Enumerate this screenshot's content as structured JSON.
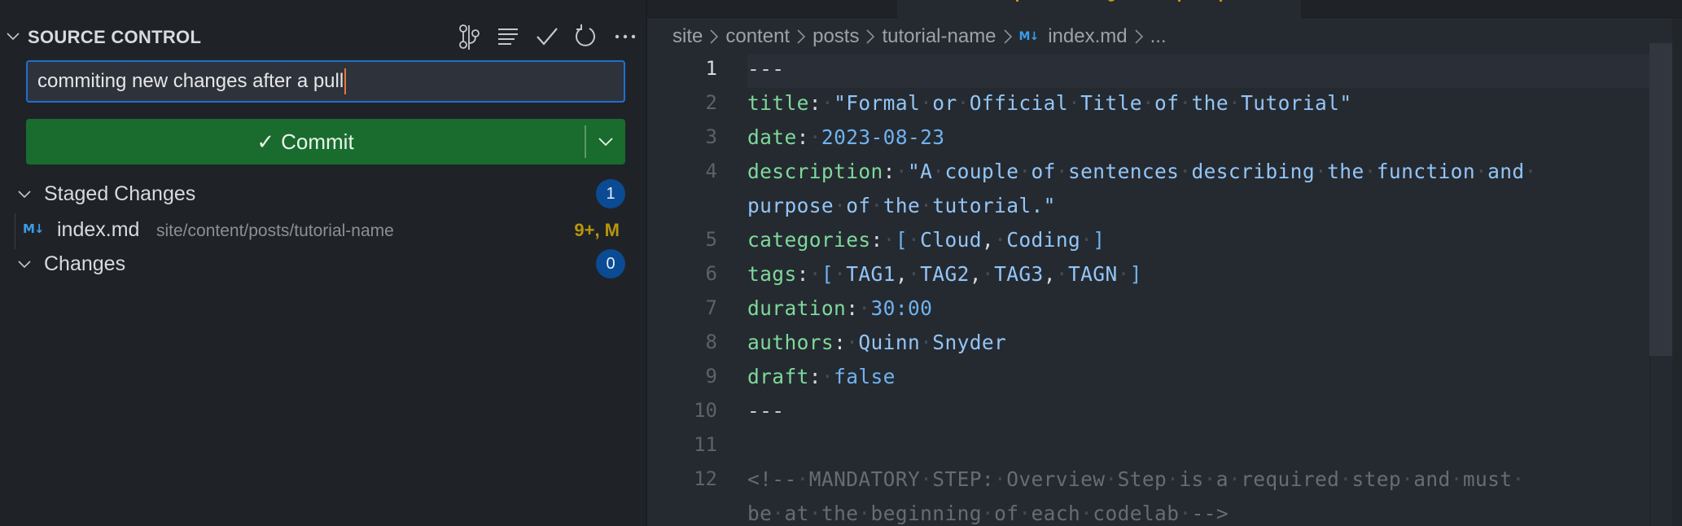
{
  "sidebar": {
    "title": "SOURCE CONTROL",
    "actions": [
      {
        "name": "view-graph",
        "icon": "git-graph-icon"
      },
      {
        "name": "view-as-tree",
        "icon": "list-icon"
      },
      {
        "name": "commit",
        "icon": "check-icon"
      },
      {
        "name": "refresh",
        "icon": "refresh-icon"
      },
      {
        "name": "more-actions",
        "icon": "ellipsis-icon"
      }
    ],
    "commit_message": "commiting new changes after a pull",
    "commit_button": {
      "check": "✓",
      "label": "Commit"
    },
    "sections": {
      "staged": {
        "label": "Staged Changes",
        "count": "1",
        "files": [
          {
            "icon": "M↓",
            "name": "index.md",
            "path": "site/content/posts/tutorial-name",
            "status": "9+, M"
          }
        ]
      },
      "changes": {
        "label": "Changes",
        "count": "0"
      }
    }
  },
  "editor": {
    "accent_modified_color": "#c89a09",
    "breadcrumb": {
      "items": [
        "site",
        "content",
        "posts",
        "tutorial-name"
      ],
      "file_icon": "M↓",
      "file": "index.md",
      "tail": "..."
    },
    "lines": [
      {
        "n": "1",
        "current": true,
        "tokens": [
          [
            "d",
            "---"
          ]
        ]
      },
      {
        "n": "2",
        "tokens": [
          [
            "k",
            "title"
          ],
          [
            "p",
            ":"
          ],
          [
            "ws",
            "·"
          ],
          [
            "s",
            "\"Formal"
          ],
          [
            "ws",
            "·"
          ],
          [
            "s",
            "or"
          ],
          [
            "ws",
            "·"
          ],
          [
            "s",
            "Official"
          ],
          [
            "ws",
            "·"
          ],
          [
            "s",
            "Title"
          ],
          [
            "ws",
            "·"
          ],
          [
            "s",
            "of"
          ],
          [
            "ws",
            "·"
          ],
          [
            "s",
            "the"
          ],
          [
            "ws",
            "·"
          ],
          [
            "s",
            "Tutorial\""
          ]
        ]
      },
      {
        "n": "3",
        "tokens": [
          [
            "k",
            "date"
          ],
          [
            "p",
            ":"
          ],
          [
            "ws",
            "·"
          ],
          [
            "n",
            "2023-08-23"
          ]
        ]
      },
      {
        "n": "4",
        "tokens": [
          [
            "k",
            "description"
          ],
          [
            "p",
            ":"
          ],
          [
            "ws",
            "·"
          ],
          [
            "s",
            "\"A"
          ],
          [
            "ws",
            "·"
          ],
          [
            "s",
            "couple"
          ],
          [
            "ws",
            "·"
          ],
          [
            "s",
            "of"
          ],
          [
            "ws",
            "·"
          ],
          [
            "s",
            "sentences"
          ],
          [
            "ws",
            "·"
          ],
          [
            "s",
            "describing"
          ],
          [
            "ws",
            "·"
          ],
          [
            "s",
            "the"
          ],
          [
            "ws",
            "·"
          ],
          [
            "s",
            "function"
          ],
          [
            "ws",
            "·"
          ],
          [
            "s",
            "and"
          ],
          [
            "ws",
            "·"
          ]
        ]
      },
      {
        "n": "",
        "tokens": [
          [
            "s",
            "purpose"
          ],
          [
            "ws",
            "·"
          ],
          [
            "s",
            "of"
          ],
          [
            "ws",
            "·"
          ],
          [
            "s",
            "the"
          ],
          [
            "ws",
            "·"
          ],
          [
            "s",
            "tutorial.\""
          ]
        ]
      },
      {
        "n": "5",
        "tokens": [
          [
            "k",
            "categories"
          ],
          [
            "p",
            ":"
          ],
          [
            "ws",
            "·"
          ],
          [
            "n",
            "["
          ],
          [
            "ws",
            "·"
          ],
          [
            "s",
            "Cloud"
          ],
          [
            "p",
            ","
          ],
          [
            "ws",
            "·"
          ],
          [
            "s",
            "Coding"
          ],
          [
            "ws",
            "·"
          ],
          [
            "n",
            "]"
          ]
        ]
      },
      {
        "n": "6",
        "tokens": [
          [
            "k",
            "tags"
          ],
          [
            "p",
            ":"
          ],
          [
            "ws",
            "·"
          ],
          [
            "n",
            "["
          ],
          [
            "ws",
            "·"
          ],
          [
            "s",
            "TAG1"
          ],
          [
            "p",
            ","
          ],
          [
            "ws",
            "·"
          ],
          [
            "s",
            "TAG2"
          ],
          [
            "p",
            ","
          ],
          [
            "ws",
            "·"
          ],
          [
            "s",
            "TAG3"
          ],
          [
            "p",
            ","
          ],
          [
            "ws",
            "·"
          ],
          [
            "s",
            "TAGN"
          ],
          [
            "ws",
            "·"
          ],
          [
            "n",
            "]"
          ]
        ]
      },
      {
        "n": "7",
        "tokens": [
          [
            "k",
            "duration"
          ],
          [
            "p",
            ":"
          ],
          [
            "ws",
            "·"
          ],
          [
            "n",
            "30:00"
          ]
        ]
      },
      {
        "n": "8",
        "tokens": [
          [
            "k",
            "authors"
          ],
          [
            "p",
            ":"
          ],
          [
            "ws",
            "·"
          ],
          [
            "s",
            "Quinn"
          ],
          [
            "ws",
            "·"
          ],
          [
            "s",
            "Snyder"
          ]
        ]
      },
      {
        "n": "9",
        "tokens": [
          [
            "k",
            "draft"
          ],
          [
            "p",
            ":"
          ],
          [
            "ws",
            "·"
          ],
          [
            "n",
            "false"
          ]
        ]
      },
      {
        "n": "10",
        "tokens": [
          [
            "d",
            "---"
          ]
        ]
      },
      {
        "n": "11",
        "tokens": []
      },
      {
        "n": "12",
        "tokens": [
          [
            "c",
            "<!--"
          ],
          [
            "ws",
            "·"
          ],
          [
            "c",
            "MANDATORY"
          ],
          [
            "ws",
            "·"
          ],
          [
            "c",
            "STEP:"
          ],
          [
            "ws",
            "·"
          ],
          [
            "c",
            "Overview"
          ],
          [
            "ws",
            "·"
          ],
          [
            "c",
            "Step"
          ],
          [
            "ws",
            "·"
          ],
          [
            "c",
            "is"
          ],
          [
            "ws",
            "·"
          ],
          [
            "c",
            "a"
          ],
          [
            "ws",
            "·"
          ],
          [
            "c",
            "required"
          ],
          [
            "ws",
            "·"
          ],
          [
            "c",
            "step"
          ],
          [
            "ws",
            "·"
          ],
          [
            "c",
            "and"
          ],
          [
            "ws",
            "·"
          ],
          [
            "c",
            "must"
          ],
          [
            "ws",
            "·"
          ]
        ]
      },
      {
        "n": "",
        "tokens": [
          [
            "c",
            "be"
          ],
          [
            "ws",
            "·"
          ],
          [
            "c",
            "at"
          ],
          [
            "ws",
            "·"
          ],
          [
            "c",
            "the"
          ],
          [
            "ws",
            "·"
          ],
          [
            "c",
            "beginning"
          ],
          [
            "ws",
            "·"
          ],
          [
            "c",
            "of"
          ],
          [
            "ws",
            "·"
          ],
          [
            "c",
            "each"
          ],
          [
            "ws",
            "·"
          ],
          [
            "c",
            "codelab"
          ],
          [
            "ws",
            "·"
          ],
          [
            "c",
            "-->"
          ]
        ]
      }
    ]
  }
}
